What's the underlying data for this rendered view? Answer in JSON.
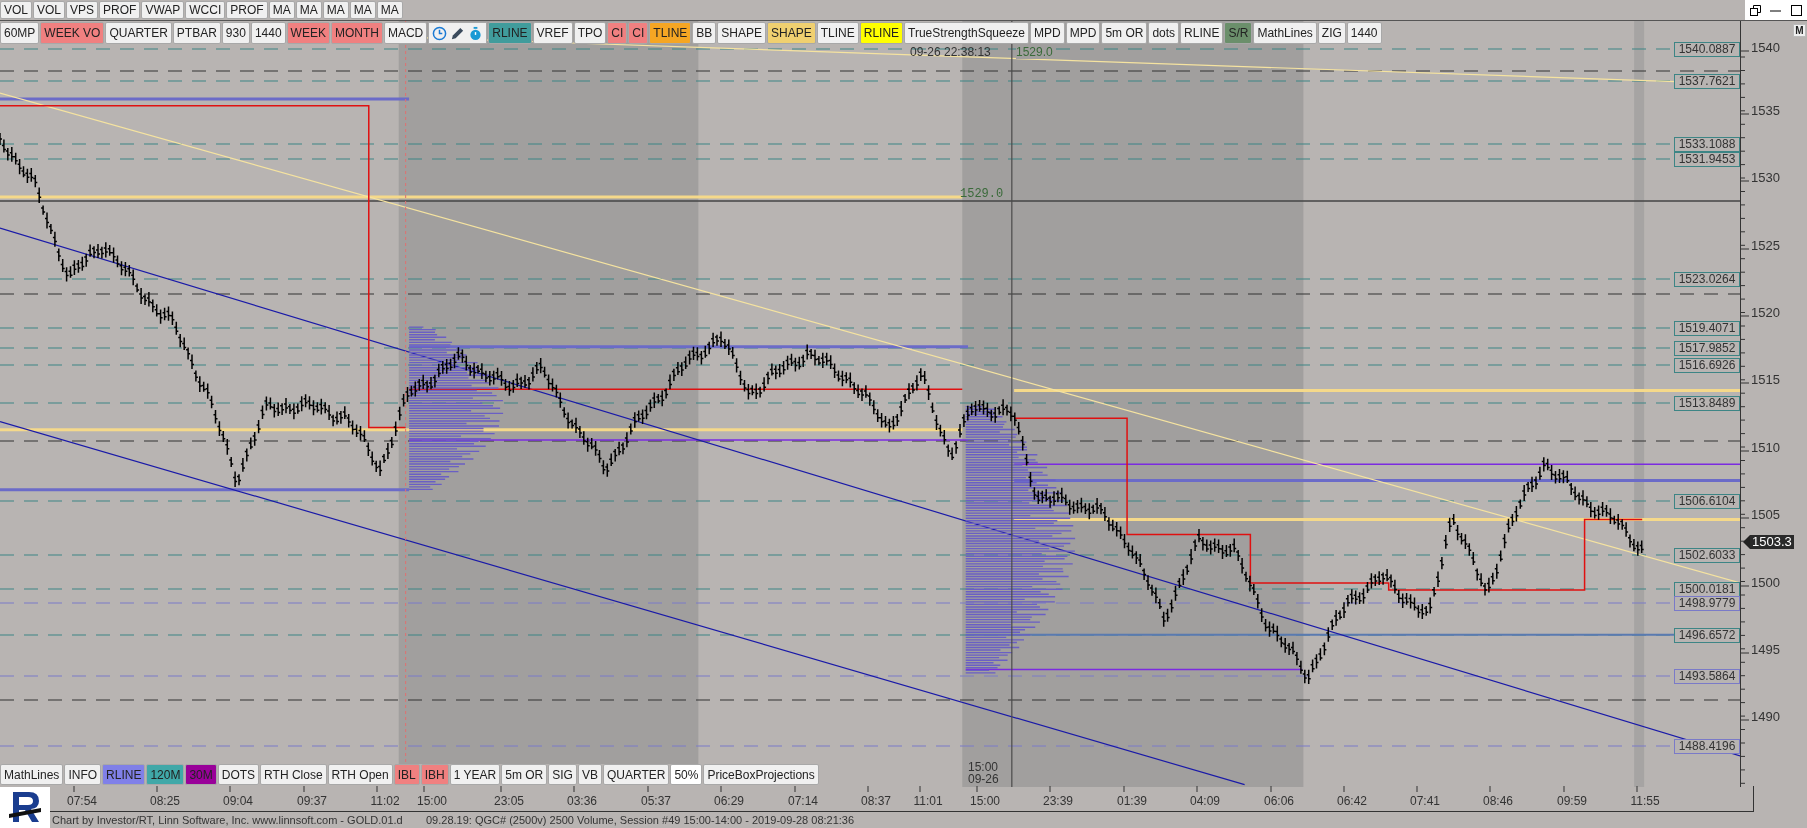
{
  "toolbar_top": [
    {
      "label": "VOL",
      "color": "#f0f0f0"
    },
    {
      "label": "VOL",
      "color": "#f0f0f0"
    },
    {
      "label": "VPS",
      "color": "#f0f0f0"
    },
    {
      "label": "PROF",
      "color": "#f0f0f0"
    },
    {
      "label": "VWAP",
      "color": "#f0f0f0"
    },
    {
      "label": "WCCI",
      "color": "#f0f0f0"
    },
    {
      "label": "PROF",
      "color": "#f0f0f0"
    },
    {
      "label": "MA",
      "color": "#f0f0f0"
    },
    {
      "label": "MA",
      "color": "#f0f0f0"
    },
    {
      "label": "MA",
      "color": "#f0f0f0"
    },
    {
      "label": "MA",
      "color": "#f0f0f0"
    },
    {
      "label": "MA",
      "color": "#f0f0f0"
    }
  ],
  "toolbar_main_left": [
    {
      "label": "60MP",
      "color": "#f0f0f0"
    },
    {
      "label": "WEEK VO",
      "color": "#f08080"
    },
    {
      "label": "QUARTER",
      "color": "#f0f0f0"
    },
    {
      "label": "PTBAR",
      "color": "#f0f0f0"
    },
    {
      "label": "930",
      "color": "#f0f0f0"
    },
    {
      "label": "1440",
      "color": "#f0f0f0"
    },
    {
      "label": "WEEK",
      "color": "#f08080"
    },
    {
      "label": "MONTH",
      "color": "#f08080"
    },
    {
      "label": "MACD",
      "color": "#f0f0f0"
    }
  ],
  "toolbar_main_right": [
    {
      "label": "RLINE",
      "color": "#409c9c"
    },
    {
      "label": "VREF",
      "color": "#f0f0f0"
    },
    {
      "label": "TPO",
      "color": "#f0f0f0"
    },
    {
      "label": "CI",
      "color": "#f08080"
    },
    {
      "label": "CI",
      "color": "#f08080"
    },
    {
      "label": "TLINE",
      "color": "#f5a623"
    },
    {
      "label": "BB",
      "color": "#f0f0f0"
    },
    {
      "label": "SHAPE",
      "color": "#f0f0f0"
    },
    {
      "label": "SHAPE",
      "color": "#f0d070"
    },
    {
      "label": "TLINE",
      "color": "#f0f0f0"
    },
    {
      "label": "RLINE",
      "color": "#ffff00"
    },
    {
      "label": "TrueStrengthSqueeze",
      "color": "#f0f0f0"
    },
    {
      "label": "MPD",
      "color": "#f0f0f0"
    },
    {
      "label": "MPD",
      "color": "#f0f0f0"
    },
    {
      "label": "5m OR",
      "color": "#f0f0f0"
    },
    {
      "label": "dots",
      "color": "#f0f0f0"
    },
    {
      "label": "RLINE",
      "color": "#f0f0f0"
    },
    {
      "label": "S/R",
      "color": "#6b8f6b"
    },
    {
      "label": "MathLines",
      "color": "#f0f0f0"
    },
    {
      "label": "ZIG",
      "color": "#f0f0f0"
    },
    {
      "label": "1440",
      "color": "#f0f0f0"
    }
  ],
  "chart": {
    "cursor_label": "09-26 22:38:13",
    "cursor_price": "1529.0",
    "price_marker": "1529.0",
    "session_time": "15:00",
    "session_date": "09-26"
  },
  "price_levels": [
    {
      "label": "1540.0887",
      "color": "#3d8585"
    },
    {
      "label": "1537.7621",
      "color": "#3d8585"
    },
    {
      "label": "1533.1088",
      "color": "#3d8585"
    },
    {
      "label": "1531.9453",
      "color": "#3d8585"
    },
    {
      "label": "1523.0264",
      "color": "#3d8585"
    },
    {
      "label": "1519.4071",
      "color": "#3d8585"
    },
    {
      "label": "1517.9852",
      "color": "#3d8585"
    },
    {
      "label": "1516.6926",
      "color": "#3d8585"
    },
    {
      "label": "1513.8489",
      "color": "#3d8585"
    },
    {
      "label": "1506.6104",
      "color": "#3d8585"
    },
    {
      "label": "1502.6033",
      "color": "#3d8585"
    },
    {
      "label": "1500.0181",
      "color": "#3d8585"
    },
    {
      "label": "1498.9779",
      "color": "#7a7ac8"
    },
    {
      "label": "1496.6572",
      "color": "#3d8585"
    },
    {
      "label": "1493.5864",
      "color": "#7a7ac8"
    },
    {
      "label": "1488.4196",
      "color": "#7a7ac8"
    }
  ],
  "price_axis": {
    "axis_button": "M",
    "ticks": [
      "1540",
      "1535",
      "1530",
      "1525",
      "1520",
      "1515",
      "1510",
      "1505",
      "1500",
      "1495",
      "1490"
    ],
    "last_price": "1503.3"
  },
  "indicator_bar": [
    {
      "label": "MathLines",
      "color": "#f0f0f0"
    },
    {
      "label": "INFO",
      "color": "#f0f0f0"
    },
    {
      "label": "RLINE",
      "color": "#8080e8"
    },
    {
      "label": "120M",
      "color": "#40a8a8"
    },
    {
      "label": "30M",
      "color": "#990099"
    },
    {
      "label": "DOTS",
      "color": "#f0f0f0"
    },
    {
      "label": "RTH Close",
      "color": "#f0f0f0"
    },
    {
      "label": "RTH Open",
      "color": "#f0f0f0"
    },
    {
      "label": "IBL",
      "color": "#f08080"
    },
    {
      "label": "IBH",
      "color": "#f08080"
    },
    {
      "label": "1 YEAR",
      "color": "#f0f0f0"
    },
    {
      "label": "5m OR",
      "color": "#f0f0f0"
    },
    {
      "label": "SIG",
      "color": "#f0f0f0"
    },
    {
      "label": "VB",
      "color": "#f0f0f0"
    },
    {
      "label": "QUARTER",
      "color": "#f0f0f0"
    },
    {
      "label": "50%",
      "color": "#ffffff"
    },
    {
      "label": "PriceBoxProjections",
      "color": "#f0f0f0"
    }
  ],
  "time_axis": [
    "07:54",
    "08:25",
    "09:04",
    "09:37",
    "11:02",
    "15:00",
    "23:05",
    "03:36",
    "05:37",
    "06:29",
    "07:14",
    "08:37",
    "11:01",
    "15:00",
    "23:39",
    "01:39",
    "04:09",
    "06:06",
    "06:42",
    "07:41",
    "08:46",
    "09:59",
    "11:55"
  ],
  "status_bar": {
    "credit": "Chart by Investor/RT, Linn Software, Inc. www.linnsoft.com - GOLD.01.d",
    "session": "09.28.19: QGC# (2500v) 2500 Volume, Session #49 15:00-14:00 - 2019-09-28 08:21:36"
  }
}
